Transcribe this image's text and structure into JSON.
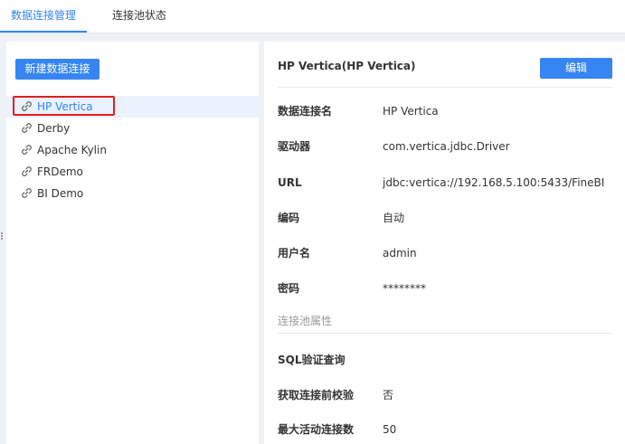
{
  "tabs": [
    {
      "label": "数据连接管理",
      "active": true
    },
    {
      "label": "连接池状态",
      "active": false
    }
  ],
  "left": {
    "new_button": "新建数据连接",
    "connections": [
      {
        "label": "HP Vertica",
        "selected": true
      },
      {
        "label": "Derby",
        "selected": false
      },
      {
        "label": "Apache Kylin",
        "selected": false
      },
      {
        "label": "FRDemo",
        "selected": false
      },
      {
        "label": "BI Demo",
        "selected": false
      }
    ],
    "icon": "link-icon"
  },
  "detail": {
    "title": "HP Vertica(HP Vertica)",
    "edit_button": "编辑",
    "props": [
      {
        "label": "数据连接名",
        "value": "HP Vertica"
      },
      {
        "label": "驱动器",
        "value": "com.vertica.jdbc.Driver"
      },
      {
        "label": "URL",
        "value": "jdbc:vertica://192.168.5.100:5433/FineBI"
      },
      {
        "label": "编码",
        "value": "自动"
      },
      {
        "label": "用户名",
        "value": "admin"
      },
      {
        "label": "密码",
        "value": "********"
      }
    ],
    "pool_section_title": "连接池属性",
    "pool_props": [
      {
        "label": "SQL验证查询",
        "value": ""
      },
      {
        "label": "获取连接前校验",
        "value": "否"
      },
      {
        "label": "最大活动连接数",
        "value": "50"
      }
    ]
  },
  "colors": {
    "accent": "#3685f2",
    "highlight": "#e02020",
    "background": "#eef1f5"
  }
}
